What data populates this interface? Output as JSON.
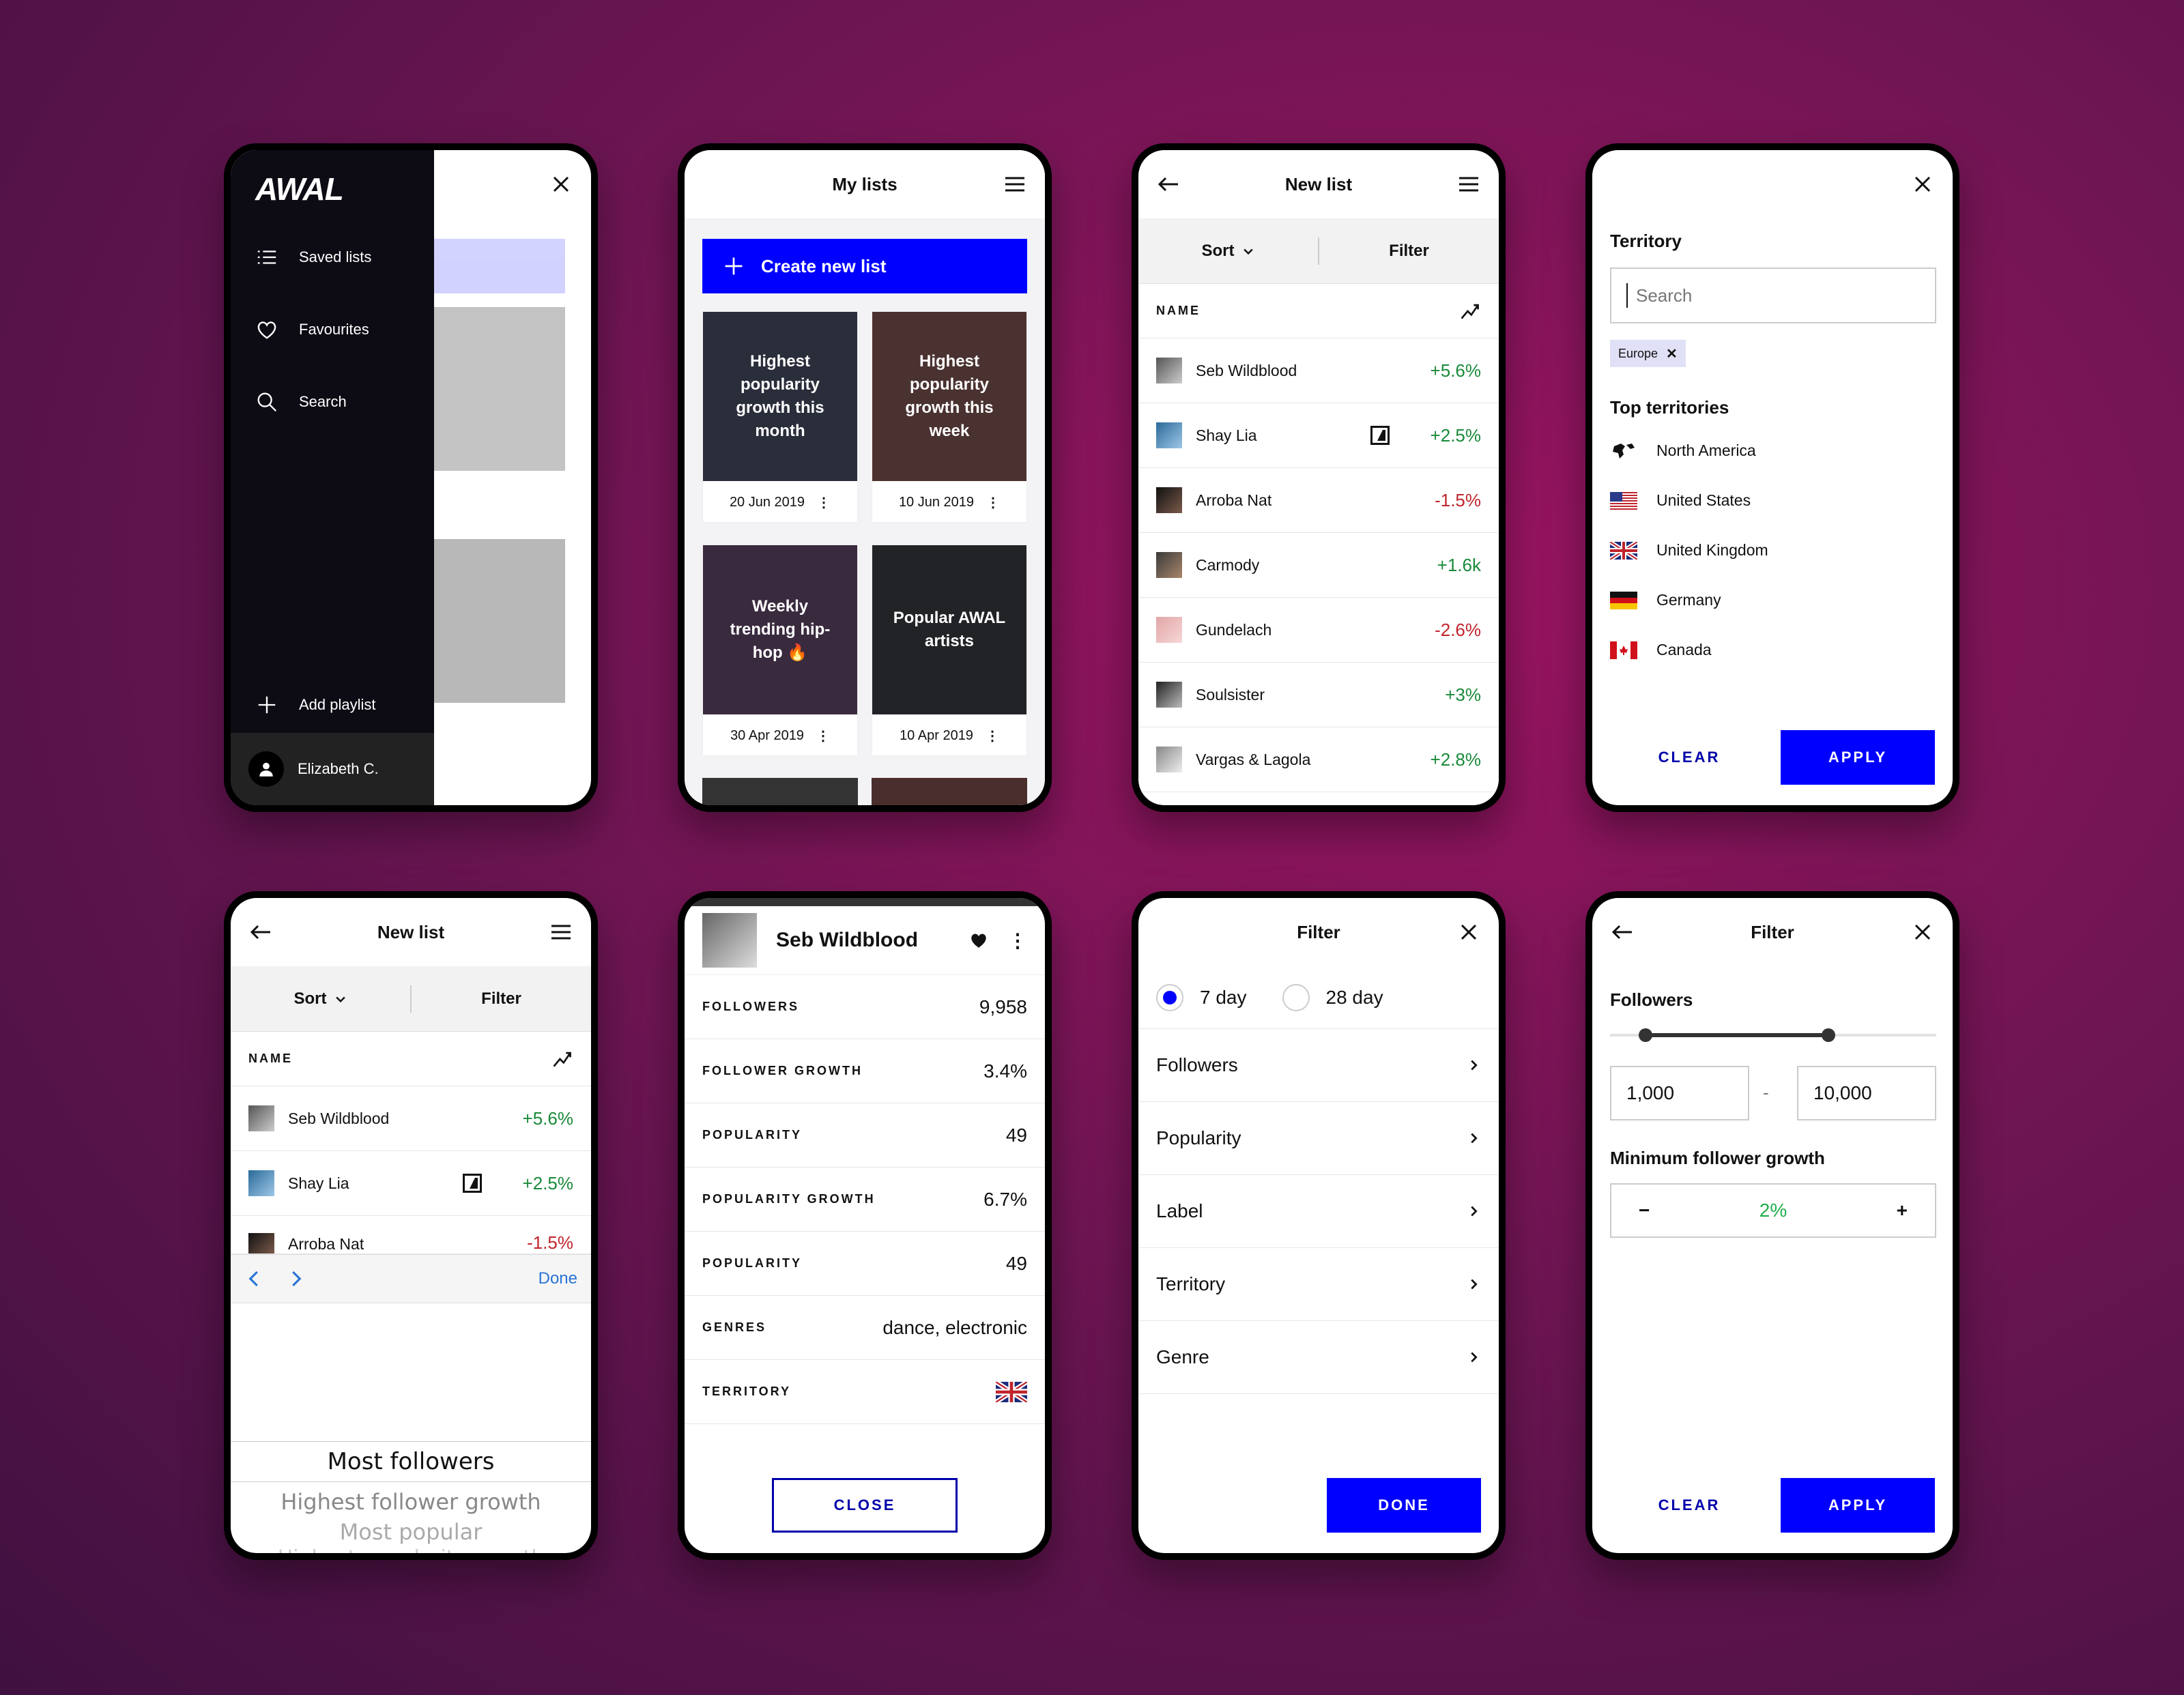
{
  "nav": {
    "logo": "AWAL",
    "items": [
      {
        "label": "Saved lists",
        "icon": "list-icon"
      },
      {
        "label": "Favourites",
        "icon": "heart-icon"
      },
      {
        "label": "Search",
        "icon": "search-icon"
      }
    ],
    "add_playlist": "Add playlist",
    "user": "Elizabeth C."
  },
  "mylists": {
    "title": "My lists",
    "create_label": "Create new list",
    "cards": [
      {
        "title": "Highest popularity growth this month",
        "date": "20 Jun 2019",
        "color": "#2a2d3a"
      },
      {
        "title": "Highest popularity growth this week",
        "date": "10 Jun 2019",
        "color": "#4a3230"
      },
      {
        "title": "Weekly trending hip-hop 🔥",
        "date": "30 Apr 2019",
        "color": "#3a2a3e"
      },
      {
        "title": "Popular AWAL artists",
        "date": "10 Apr 2019",
        "color": "#222327"
      }
    ]
  },
  "newlist": {
    "title": "New list",
    "sort_label": "Sort",
    "filter_label": "Filter",
    "name_header": "NAME",
    "artists": [
      {
        "name": "Seb Wildblood",
        "change": "+5.6%",
        "positive": true,
        "label_icon": false
      },
      {
        "name": "Shay Lia",
        "change": "+2.5%",
        "positive": true,
        "label_icon": true
      },
      {
        "name": "Arroba Nat",
        "change": "-1.5%",
        "positive": false,
        "label_icon": false
      },
      {
        "name": "Carmody",
        "change": "+1.6k",
        "positive": true,
        "label_icon": false
      },
      {
        "name": "Gundelach",
        "change": "-2.6%",
        "positive": false,
        "label_icon": false
      },
      {
        "name": "Soulsister",
        "change": "+3%",
        "positive": true,
        "label_icon": false
      },
      {
        "name": "Vargas & Lagola",
        "change": "+2.8%",
        "positive": true,
        "label_icon": false
      }
    ]
  },
  "territory": {
    "heading": "Territory",
    "search_placeholder": "Search",
    "chip": "Europe",
    "top_heading": "Top territories",
    "items": [
      "North America",
      "United States",
      "United Kingdom",
      "Germany",
      "Canada"
    ],
    "clear": "CLEAR",
    "apply": "APPLY"
  },
  "picker": {
    "done": "Done",
    "options": [
      "Most followers",
      "Highest follower growth",
      "Most popular",
      "Highest popularity growth"
    ]
  },
  "artist": {
    "name": "Seb Wildblood",
    "stats": [
      {
        "key": "FOLLOWERS",
        "value": "9,958"
      },
      {
        "key": "FOLLOWER GROWTH",
        "value": "3.4%"
      },
      {
        "key": "POPULARITY",
        "value": "49"
      },
      {
        "key": "POPULARITY GROWTH",
        "value": "6.7%"
      },
      {
        "key": "POPULARITY",
        "value": "49"
      },
      {
        "key": "GENRES",
        "value": "dance, electronic"
      }
    ],
    "territory_key": "TERRITORY",
    "close": "CLOSE"
  },
  "filter": {
    "title": "Filter",
    "period_7": "7 day",
    "period_28": "28 day",
    "rows": [
      "Followers",
      "Popularity",
      "Label",
      "Territory",
      "Genre"
    ],
    "done": "DONE"
  },
  "followers_filter": {
    "title": "Filter",
    "followers_heading": "Followers",
    "min": "1,000",
    "dash": "-",
    "max": "10,000",
    "growth_heading": "Minimum follower growth",
    "minus": "−",
    "growth_value": "2%",
    "plus": "+",
    "clear": "CLEAR",
    "apply": "APPLY"
  },
  "colors": {
    "accent": "#0000ff",
    "positive": "#1a8a3a",
    "negative": "#c0242c",
    "nav_bg": "#0d0c14"
  }
}
